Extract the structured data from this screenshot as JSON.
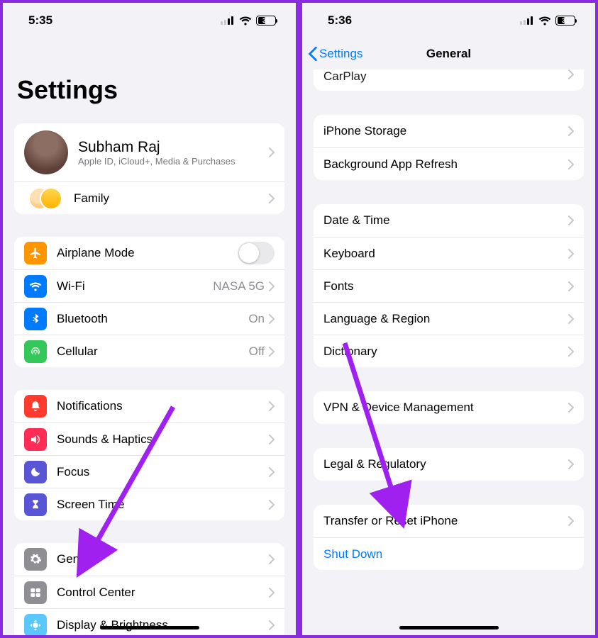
{
  "left": {
    "status_time": "5:35",
    "battery_pct": "31",
    "title": "Settings",
    "profile": {
      "name": "Subham Raj",
      "sub": "Apple ID, iCloud+, Media & Purchases"
    },
    "family_label": "Family",
    "rows_net": [
      {
        "label": "Airplane Mode",
        "toggle": true
      },
      {
        "label": "Wi-Fi",
        "detail": "NASA 5G"
      },
      {
        "label": "Bluetooth",
        "detail": "On"
      },
      {
        "label": "Cellular",
        "detail": "Off"
      }
    ],
    "rows_notif": [
      {
        "label": "Notifications"
      },
      {
        "label": "Sounds & Haptics"
      },
      {
        "label": "Focus"
      },
      {
        "label": "Screen Time"
      }
    ],
    "rows_gen": [
      {
        "label": "General"
      },
      {
        "label": "Control Center"
      },
      {
        "label": "Display & Brightness"
      }
    ]
  },
  "right": {
    "status_time": "5:36",
    "battery_pct": "31",
    "back_label": "Settings",
    "nav_title": "General",
    "partial_top": "CarPlay",
    "g1": [
      "iPhone Storage",
      "Background App Refresh"
    ],
    "g2": [
      "Date & Time",
      "Keyboard",
      "Fonts",
      "Language & Region",
      "Dictionary"
    ],
    "g3": [
      "VPN & Device Management"
    ],
    "g4": [
      "Legal & Regulatory"
    ],
    "g5_row": "Transfer or Reset iPhone",
    "g5_shutdown": "Shut Down"
  }
}
